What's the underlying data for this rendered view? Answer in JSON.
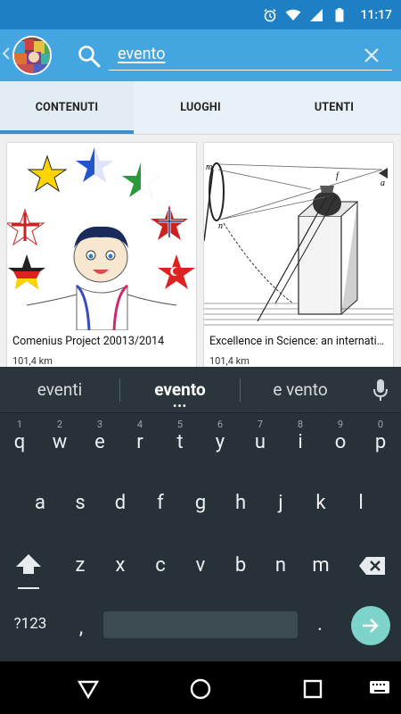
{
  "status_bar": {
    "time": "11:17",
    "icons": [
      "alarm-icon",
      "wifi-icon",
      "signal-icon",
      "battery-icon"
    ]
  },
  "app_bar": {
    "back_icon": "chevron-left-icon",
    "search": {
      "value": "evento",
      "placeholder": ""
    },
    "clear_icon": "close-icon"
  },
  "tabs": [
    {
      "label": "CONTENUTI",
      "active": true
    },
    {
      "label": "LUOGHI",
      "active": false
    },
    {
      "label": "UTENTI",
      "active": false
    }
  ],
  "cards": [
    {
      "title": "Comenius Project 20013/2014",
      "distance": "101,4 km"
    },
    {
      "title": "Excellence in Science: an internati…",
      "distance": "101,4 km"
    }
  ],
  "keyboard": {
    "suggestions": [
      "eventi",
      "evento",
      "e vento"
    ],
    "row1": [
      {
        "key": "q",
        "hint": "1"
      },
      {
        "key": "w",
        "hint": "2"
      },
      {
        "key": "e",
        "hint": "3"
      },
      {
        "key": "r",
        "hint": "4"
      },
      {
        "key": "t",
        "hint": "5"
      },
      {
        "key": "y",
        "hint": "6"
      },
      {
        "key": "u",
        "hint": "7"
      },
      {
        "key": "i",
        "hint": "8"
      },
      {
        "key": "o",
        "hint": "9"
      },
      {
        "key": "p",
        "hint": "0"
      }
    ],
    "row2": [
      "a",
      "s",
      "d",
      "f",
      "g",
      "h",
      "j",
      "k",
      "l"
    ],
    "row3": [
      "z",
      "x",
      "c",
      "v",
      "b",
      "n",
      "m"
    ],
    "symbols_label": "?123",
    "comma": ",",
    "period": "."
  },
  "colors": {
    "status_bar": "#1e7fc4",
    "app_bar": "#45a5e0",
    "tab_indicator": "#3a8fd0",
    "keyboard_bg": "#263238",
    "enter_key": "#7ed3cb"
  }
}
